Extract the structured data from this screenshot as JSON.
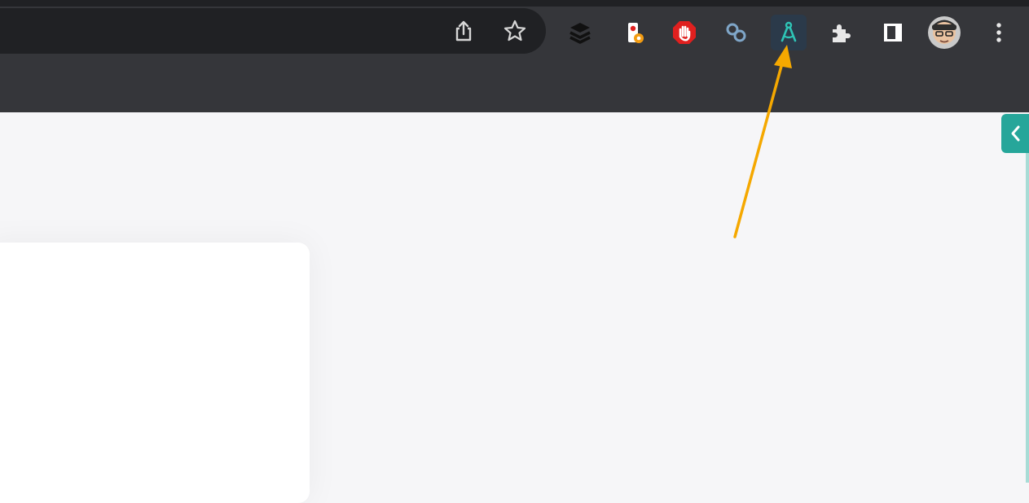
{
  "browser": {
    "omnibox": {
      "share_icon": "share-icon",
      "bookmark_icon": "star-icon"
    },
    "extensions": [
      {
        "name": "buffer",
        "icon": "stacked-layers-icon"
      },
      {
        "name": "traffic-light-badge",
        "icon": "traffic-light-icon"
      },
      {
        "name": "adblock",
        "icon": "red-hand-stop-icon"
      },
      {
        "name": "link-tool",
        "icon": "chain-link-icon"
      },
      {
        "name": "compass-tool",
        "icon": "compass-icon",
        "highlighted": true
      },
      {
        "name": "extensions-menu",
        "icon": "puzzle-icon"
      },
      {
        "name": "side-panel",
        "icon": "side-panel-icon"
      }
    ],
    "profile": {
      "icon": "avatar"
    },
    "menu": {
      "icon": "kebab-menu-icon"
    }
  },
  "page": {
    "side_panel_toggle_icon": "chevron-left-icon"
  },
  "annotation": {
    "arrow_color": "#f5a800",
    "points_to": "compass-tool"
  },
  "colors": {
    "toolbar": "#35363a",
    "omnibox": "#202124",
    "page_bg": "#f6f6f8",
    "accent_teal": "#26a69a"
  }
}
